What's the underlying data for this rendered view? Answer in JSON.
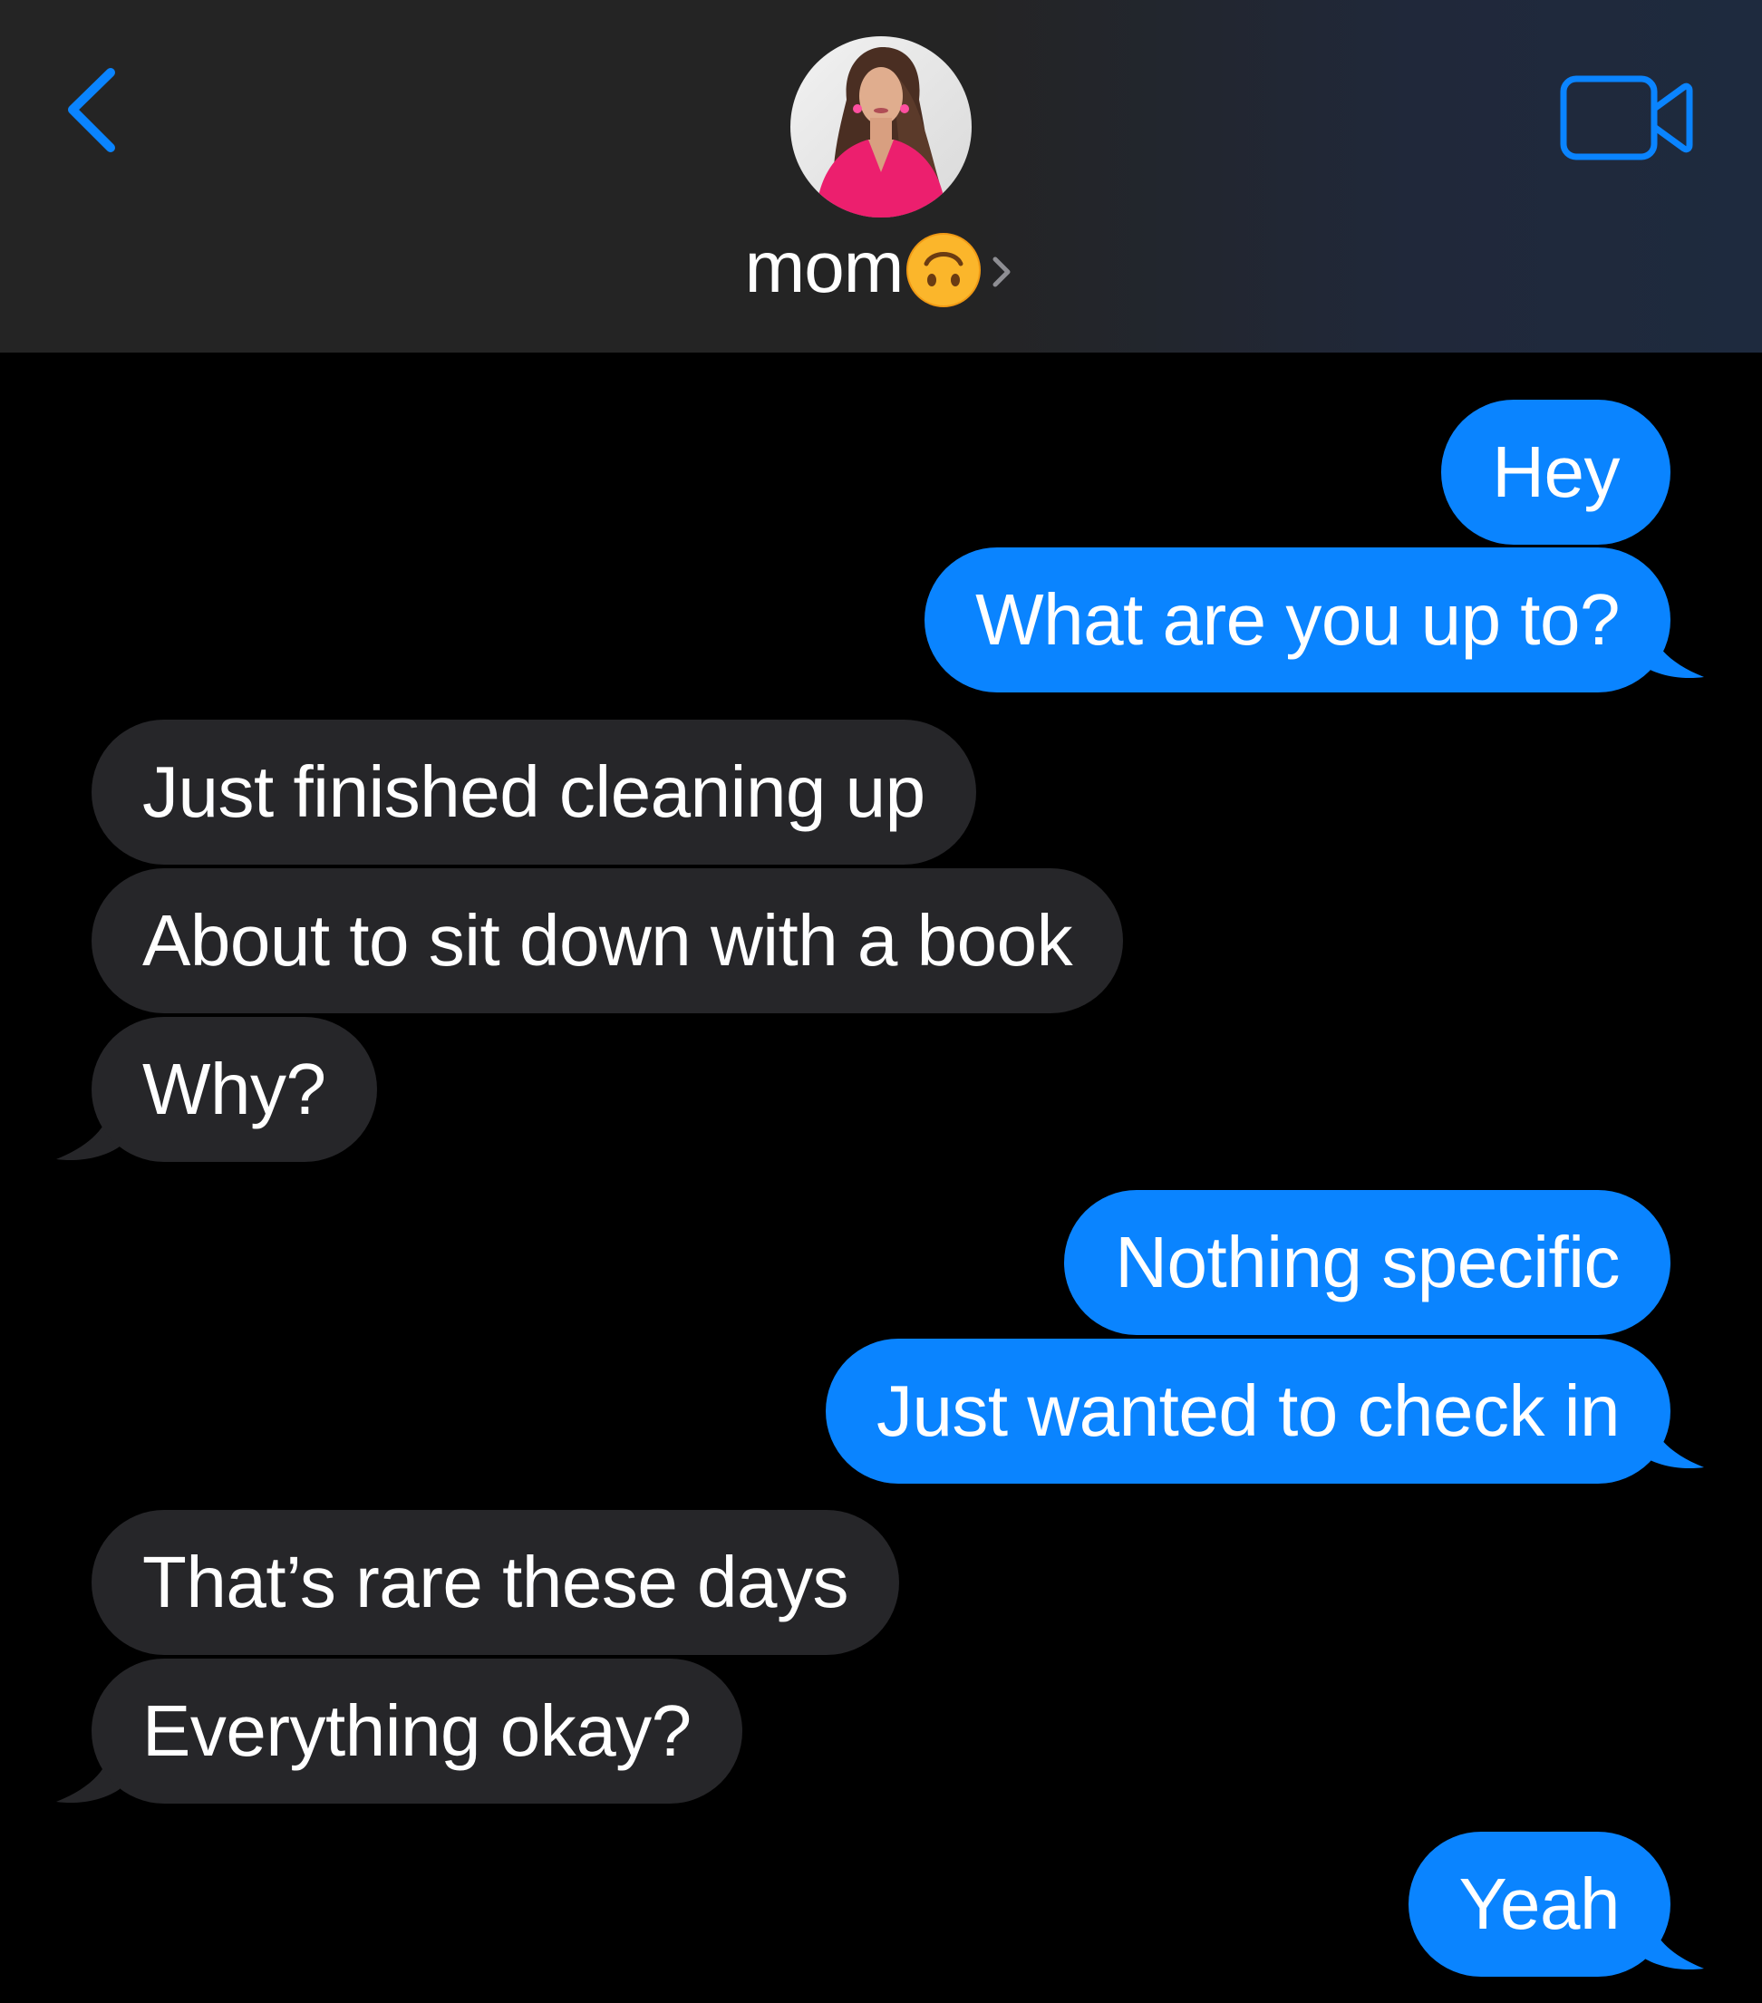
{
  "header": {
    "contact_name": "mom",
    "contact_emoji": "upside-down-face",
    "back_icon": "chevron-left-icon",
    "video_icon": "video-camera-icon",
    "accent_color": "#0a84ff"
  },
  "messages": [
    {
      "sender": "me",
      "text": "Hey"
    },
    {
      "sender": "me",
      "text": "What are you up to?"
    },
    {
      "sender": "them",
      "text": "Just finished cleaning up"
    },
    {
      "sender": "them",
      "text": "About to sit down with a book"
    },
    {
      "sender": "them",
      "text": "Why?"
    },
    {
      "sender": "me",
      "text": "Nothing specific"
    },
    {
      "sender": "me",
      "text": "Just wanted to check in"
    },
    {
      "sender": "them",
      "text": "That’s rare these days"
    },
    {
      "sender": "them",
      "text": "Everything okay?"
    },
    {
      "sender": "me",
      "text": "Yeah"
    }
  ],
  "colors": {
    "sent_bubble": "#0a84ff",
    "received_bubble": "#262629",
    "background": "#000000"
  }
}
